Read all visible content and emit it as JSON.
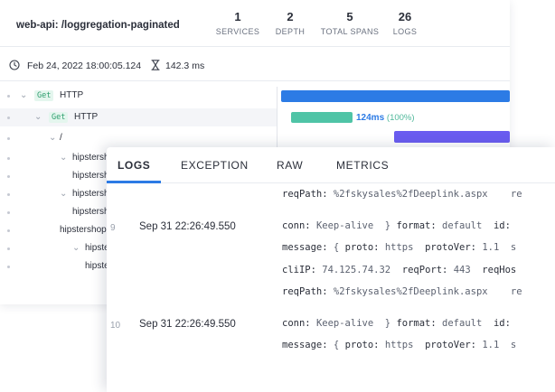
{
  "trace": {
    "title": "web-api: /loggregation-paginated",
    "stats": [
      {
        "value": "1",
        "label": "SERVICES"
      },
      {
        "value": "2",
        "label": "DEPTH"
      },
      {
        "value": "5",
        "label": "TOTAL SPANS"
      },
      {
        "value": "26",
        "label": "LOGS"
      }
    ],
    "date": "Feb 24, 2022 18:00:05.124",
    "duration": "142.3 ms",
    "tree": [
      {
        "method": "Get",
        "label": "HTTP"
      },
      {
        "method": "Get",
        "label": "HTTP"
      },
      {
        "label": "/"
      },
      {
        "label": "hipstersh"
      },
      {
        "label": "hipstersh"
      },
      {
        "label": "hipstersh"
      },
      {
        "label": "hipstersh"
      },
      {
        "label": "hipstershop"
      },
      {
        "label": "hipste"
      },
      {
        "label": "hipste"
      }
    ],
    "child_bar": {
      "duration": "124ms",
      "percent": "(100%)"
    }
  },
  "logs": {
    "tabs": [
      {
        "label": "LOGS",
        "active": true
      },
      {
        "label": "EXCEPTION",
        "active": false
      },
      {
        "label": "RAW",
        "active": false
      },
      {
        "label": "METRICS",
        "active": false
      }
    ],
    "entries": [
      {
        "number": "",
        "time": "",
        "lines": [
          [
            {
              "k": "reqPath: "
            },
            {
              "v": "%2fskysales%2fDeeplink.aspx    re"
            }
          ]
        ]
      },
      {
        "number": "9",
        "time": "Sep 31 22:26:49.550",
        "lines": [
          [
            {
              "k": "conn: "
            },
            {
              "v": "Keep-alive  } "
            },
            {
              "k": "format: "
            },
            {
              "v": "default  "
            },
            {
              "k": "id: "
            }
          ],
          [
            {
              "k": "message: "
            },
            {
              "v": "{ "
            },
            {
              "k": "proto: "
            },
            {
              "v": "https  "
            },
            {
              "k": "protoVer: "
            },
            {
              "v": "1.1  s"
            }
          ],
          [
            {
              "k": "cliIP: "
            },
            {
              "v": "74.125.74.32  "
            },
            {
              "k": "reqPort: "
            },
            {
              "v": "443  "
            },
            {
              "k": "reqHos"
            }
          ],
          [
            {
              "k": "reqPath: "
            },
            {
              "v": "%2fskysales%2fDeeplink.aspx    re"
            }
          ]
        ]
      },
      {
        "number": "10",
        "time": "Sep 31 22:26:49.550",
        "lines": [
          [
            {
              "k": "conn: "
            },
            {
              "v": "Keep-alive  } "
            },
            {
              "k": "format: "
            },
            {
              "v": "default  "
            },
            {
              "k": "id: "
            }
          ],
          [
            {
              "k": "message: "
            },
            {
              "v": "{ "
            },
            {
              "k": "proto: "
            },
            {
              "v": "https  "
            },
            {
              "k": "protoVer: "
            },
            {
              "v": "1.1  s"
            }
          ]
        ]
      }
    ]
  }
}
